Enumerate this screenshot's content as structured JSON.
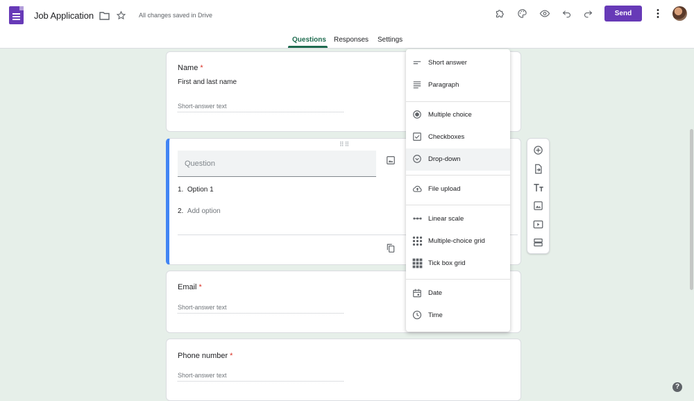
{
  "app": {
    "title": "Job Application",
    "save_status": "All changes saved in Drive",
    "send_label": "Send"
  },
  "tabs": [
    {
      "label": "Questions",
      "active": true
    },
    {
      "label": "Responses"
    },
    {
      "label": "Settings"
    }
  ],
  "questions": [
    {
      "title": "Name",
      "required": "*",
      "description": "First and last name",
      "answer_placeholder": "Short-answer text"
    },
    {
      "title_placeholder": "Question",
      "options": [
        {
          "number": "1.",
          "label": "Option 1"
        },
        {
          "number": "2.",
          "label": "Add option"
        }
      ]
    },
    {
      "title": "Email",
      "required": "*",
      "answer_placeholder": "Short-answer text"
    },
    {
      "title": "Phone number",
      "required": "*",
      "answer_placeholder": "Short-answer text"
    }
  ],
  "type_menu": {
    "items": [
      {
        "label": "Short answer",
        "icon": "short-answer-icon"
      },
      {
        "label": "Paragraph",
        "icon": "paragraph-icon"
      },
      {
        "label": "Multiple choice",
        "icon": "radio-icon"
      },
      {
        "label": "Checkboxes",
        "icon": "checkbox-icon"
      },
      {
        "label": "Drop-down",
        "icon": "dropdown-icon",
        "highlighted": true
      },
      {
        "label": "File upload",
        "icon": "cloud-upload-icon"
      },
      {
        "label": "Linear scale",
        "icon": "linear-scale-icon"
      },
      {
        "label": "Multiple-choice grid",
        "icon": "grid-dots-icon"
      },
      {
        "label": "Tick box grid",
        "icon": "grid-squares-icon"
      },
      {
        "label": "Date",
        "icon": "calendar-icon"
      },
      {
        "label": "Time",
        "icon": "clock-icon"
      }
    ]
  },
  "help": {
    "label": "?"
  },
  "colors": {
    "brand": "#673ab7",
    "accent": "#1e6b4f",
    "active_border": "#4285f4",
    "required": "#d93025",
    "background": "#e6efe9"
  }
}
